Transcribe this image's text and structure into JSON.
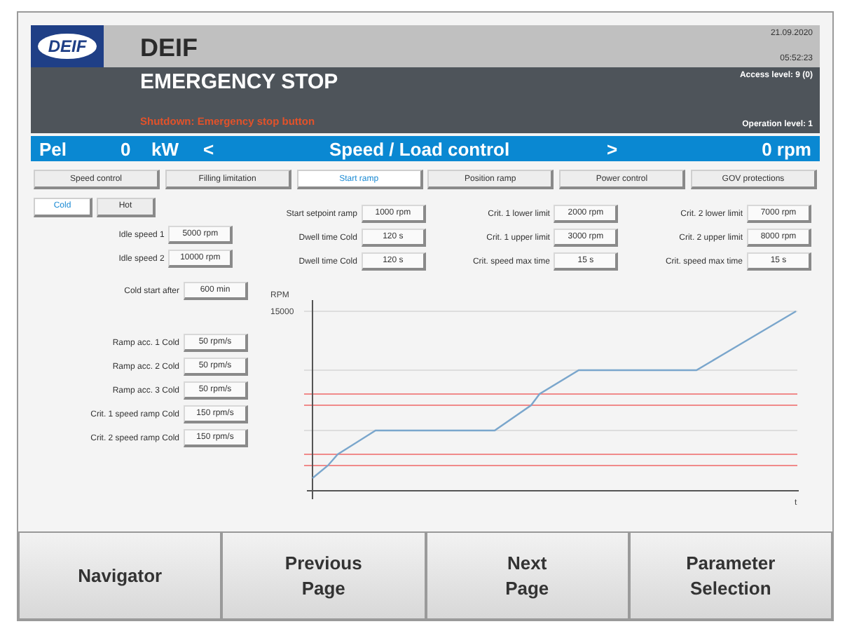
{
  "header": {
    "logo": "DEIF",
    "title": "DEIF",
    "date": "21.09.2020",
    "time": "05:52:23",
    "alarm": "EMERGENCY STOP",
    "alarm_detail": "Shutdown: Emergency stop button",
    "access_level": "Access level: 9 (0)",
    "operation_level": "Operation level: 1"
  },
  "status_bar": {
    "power_label": "Pel",
    "power_value": "0",
    "power_unit": "kW",
    "prev": "<",
    "title": "Speed / Load control",
    "next": ">",
    "speed": "0 rpm"
  },
  "tabs": [
    {
      "label": "Speed control",
      "selected": false
    },
    {
      "label": "Filling limitation",
      "selected": false
    },
    {
      "label": "Start ramp",
      "selected": true
    },
    {
      "label": "Position ramp",
      "selected": false
    },
    {
      "label": "Power control",
      "selected": false
    },
    {
      "label": "GOV protections",
      "selected": false
    }
  ],
  "mode_tabs": [
    {
      "label": "Cold",
      "selected": true
    },
    {
      "label": "Hot",
      "selected": false
    }
  ],
  "parameter_columns": [
    [
      {
        "label": "Idle speed 1",
        "value": "5000 rpm"
      },
      {
        "label": "Idle speed 2",
        "value": "10000 rpm"
      }
    ],
    [
      {
        "label": "Start setpoint ramp",
        "value": "1000 rpm"
      },
      {
        "label": "Dwell time Cold",
        "value": "120 s"
      },
      {
        "label": "Dwell time Cold",
        "value": "120 s"
      }
    ],
    [
      {
        "label": "Crit. 1 lower limit",
        "value": "2000 rpm"
      },
      {
        "label": "Crit. 1 upper limit",
        "value": "3000 rpm"
      },
      {
        "label": "Crit. speed max time",
        "value": "15 s"
      }
    ],
    [
      {
        "label": "Crit. 2 lower limit",
        "value": "7000 rpm"
      },
      {
        "label": "Crit. 2 upper limit",
        "value": "8000 rpm"
      },
      {
        "label": "Crit. speed max time",
        "value": "15 s"
      }
    ]
  ],
  "cold_start": {
    "label": "Cold start after",
    "value": "600 min"
  },
  "ramp_parameters": [
    {
      "label": "Ramp acc. 1 Cold",
      "value": "50 rpm/s"
    },
    {
      "label": "Ramp acc. 2 Cold",
      "value": "50 rpm/s"
    },
    {
      "label": "Ramp acc. 3 Cold",
      "value": "50 rpm/s"
    },
    {
      "label": "Crit. 1 speed ramp Cold",
      "value": "150 rpm/s"
    },
    {
      "label": "Crit. 2 speed ramp Cold",
      "value": "150 rpm/s"
    }
  ],
  "chart": {
    "ylabel": "RPM",
    "ytick": "15000",
    "xlabel": "t"
  },
  "nav_buttons": [
    [
      "Navigator"
    ],
    [
      "Previous",
      "Page"
    ],
    [
      "Next",
      "Page"
    ],
    [
      "Parameter",
      "Selection"
    ]
  ]
}
